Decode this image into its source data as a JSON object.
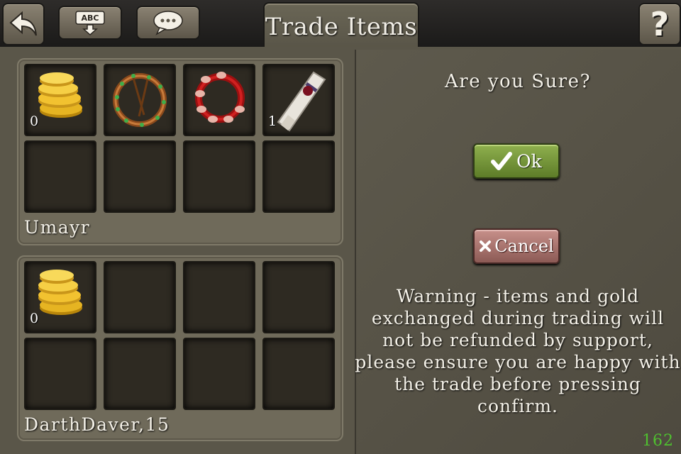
{
  "header": {
    "back_icon": "back-arrow-icon",
    "keyboard_icon": "abc-keyboard-icon",
    "keyboard_label": "ABC",
    "chat_icon": "chat-bubble-icon",
    "tab_title": "Trade Items",
    "help_icon": "help-question-icon",
    "help_label": "?"
  },
  "players": [
    {
      "name": "Umayr",
      "slots": [
        {
          "item": "gold-coins-icon",
          "count": "0"
        },
        {
          "item": "thorn-wreath-icon",
          "count": ""
        },
        {
          "item": "red-bead-necklace-icon",
          "count": ""
        },
        {
          "item": "scroll-icon",
          "count": "1"
        },
        {
          "item": "",
          "count": ""
        },
        {
          "item": "",
          "count": ""
        },
        {
          "item": "",
          "count": ""
        },
        {
          "item": "",
          "count": ""
        }
      ]
    },
    {
      "name": "DarthDaver,15",
      "slots": [
        {
          "item": "gold-coins-icon",
          "count": "0"
        },
        {
          "item": "",
          "count": ""
        },
        {
          "item": "",
          "count": ""
        },
        {
          "item": "",
          "count": ""
        },
        {
          "item": "",
          "count": ""
        },
        {
          "item": "",
          "count": ""
        },
        {
          "item": "",
          "count": ""
        },
        {
          "item": "",
          "count": ""
        }
      ]
    }
  ],
  "confirm": {
    "question": "Are you Sure?",
    "ok_label": "Ok",
    "cancel_label": "Cancel",
    "warning": "Warning - items and gold exchanged during trading will not be refunded by support, please ensure you are happy with the trade before pressing confirm."
  },
  "counter": "162",
  "colors": {
    "ok_green": "#6f9236",
    "cancel_red": "#a8716b",
    "counter_green": "#4fc02f"
  }
}
